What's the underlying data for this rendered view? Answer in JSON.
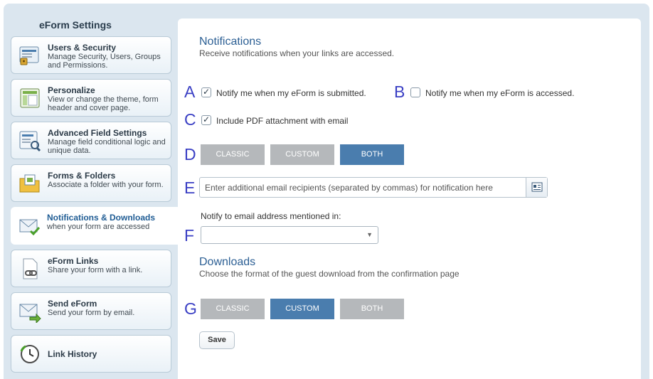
{
  "sidebar": {
    "title": "eForm Settings",
    "items": [
      {
        "label": "Users & Security",
        "desc": "Manage Security, Users, Groups and Permissions.",
        "icon": "users-security-icon"
      },
      {
        "label": "Personalize",
        "desc": "View or change the theme, form header and cover page.",
        "icon": "personalize-icon"
      },
      {
        "label": "Advanced Field Settings",
        "desc": "Manage field conditional logic and unique data.",
        "icon": "advanced-field-icon"
      },
      {
        "label": "Forms & Folders",
        "desc": "Associate a folder with your form.",
        "icon": "folder-icon"
      },
      {
        "label": "Notifications & Downloads",
        "desc": "when your form are accessed",
        "icon": "notification-envelope-icon",
        "active": true
      },
      {
        "label": "eForm Links",
        "desc": "Share your form with a link.",
        "icon": "link-icon"
      },
      {
        "label": "Send eForm",
        "desc": "Send your form by email.",
        "icon": "send-mail-icon"
      },
      {
        "label": "Link History",
        "desc": "",
        "icon": "history-clock-icon"
      }
    ]
  },
  "notifications": {
    "title": "Notifications",
    "subtitle": "Receive notifications when your links are accessed.",
    "submitted": {
      "marker": "A",
      "label": "Notify me when my eForm is submitted.",
      "checked": true
    },
    "accessed": {
      "marker": "B",
      "label": "Notify me when my eForm is accessed.",
      "checked": false
    },
    "pdf": {
      "marker": "C",
      "label": "Include PDF attachment with email",
      "checked": true
    },
    "format": {
      "marker": "D",
      "options": [
        "CLASSIC",
        "CUSTOM",
        "BOTH"
      ],
      "selected": "BOTH"
    },
    "email": {
      "marker": "E",
      "placeholder": "Enter additional email recipients (separated by commas) for notification here",
      "value": ""
    },
    "notify_to": {
      "marker": "F",
      "label": "Notify to email address mentioned in:",
      "value": ""
    }
  },
  "downloads": {
    "title": "Downloads",
    "subtitle": "Choose the format of the guest download from the confirmation page",
    "format": {
      "marker": "G",
      "options": [
        "CLASSIC",
        "CUSTOM",
        "BOTH"
      ],
      "selected": "CUSTOM"
    }
  },
  "save_label": "Save",
  "colors": {
    "accent": "#4a7dae",
    "marker": "#3a3fc4",
    "title": "#2c5f94",
    "background": "#dbe6ef"
  }
}
